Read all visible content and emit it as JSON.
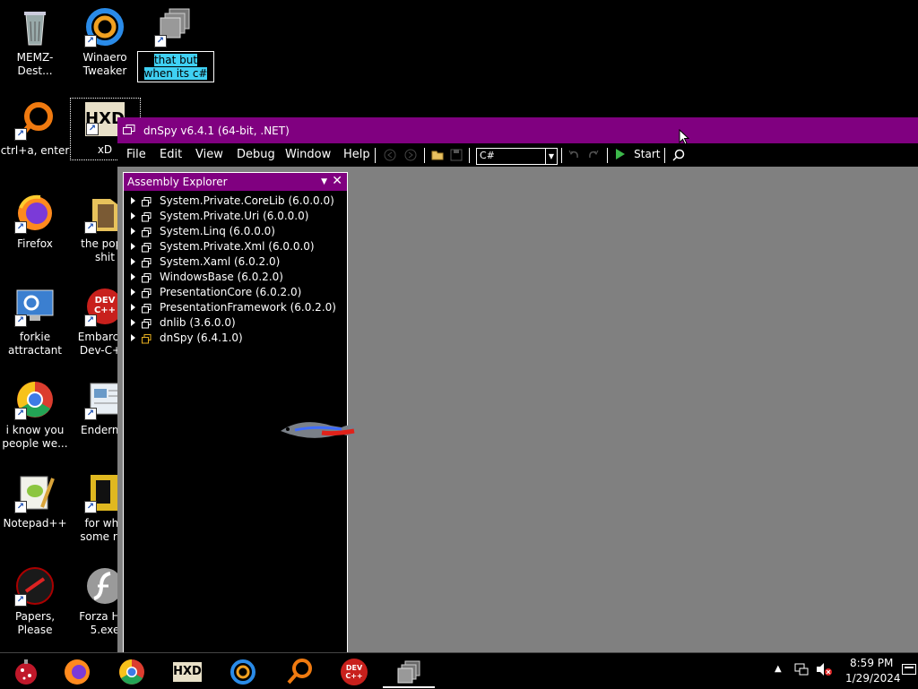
{
  "desktop": {
    "icons": [
      {
        "label": "MEMZ-Dest..."
      },
      {
        "label": "Winaero Tweaker"
      },
      {
        "label": "that but when its c#"
      },
      {
        "label": "ctrl+a, enter"
      },
      {
        "label": "xD"
      },
      {
        "label": "Firefox"
      },
      {
        "label": "the popp shit"
      },
      {
        "label": "forkie attractant"
      },
      {
        "label": "Embarcad Dev-C++"
      },
      {
        "label": "i know you people we..."
      },
      {
        "label": "Enderma"
      },
      {
        "label": "Notepad++"
      },
      {
        "label": "for whe some rus"
      },
      {
        "label": "Papers, Please"
      },
      {
        "label": "Forza Hor 5.exe"
      }
    ],
    "hxd_text": "HXD",
    "devcpp_text": "DEV C++"
  },
  "window": {
    "title": "dnSpy v6.4.1 (64-bit, .NET)",
    "menu": [
      "File",
      "Edit",
      "View",
      "Debug",
      "Window",
      "Help"
    ],
    "language": "C#",
    "start_label": "Start",
    "colors": {
      "titlebar": "#800080",
      "content": "#808080"
    }
  },
  "assembly_explorer": {
    "title": "Assembly Explorer",
    "items": [
      "System.Private.CoreLib (6.0.0.0)",
      "System.Private.Uri (6.0.0.0)",
      "System.Linq (6.0.0.0)",
      "System.Private.Xml (6.0.0.0)",
      "System.Xaml (6.0.2.0)",
      "WindowsBase (6.0.2.0)",
      "PresentationCore (6.0.2.0)",
      "PresentationFramework (6.0.2.0)",
      "dnlib (3.6.0.0)",
      "dnSpy (6.4.1.0)"
    ]
  },
  "taskbar": {
    "apps": [
      "start-icon",
      "firefox-icon",
      "chrome-icon",
      "hxd-icon",
      "winaero-icon",
      "search-magnifier-icon",
      "devcpp-icon",
      "dnspy-icon"
    ],
    "devcpp_text": "DEV C++",
    "time": "8:59 PM",
    "date": "1/29/2024"
  }
}
